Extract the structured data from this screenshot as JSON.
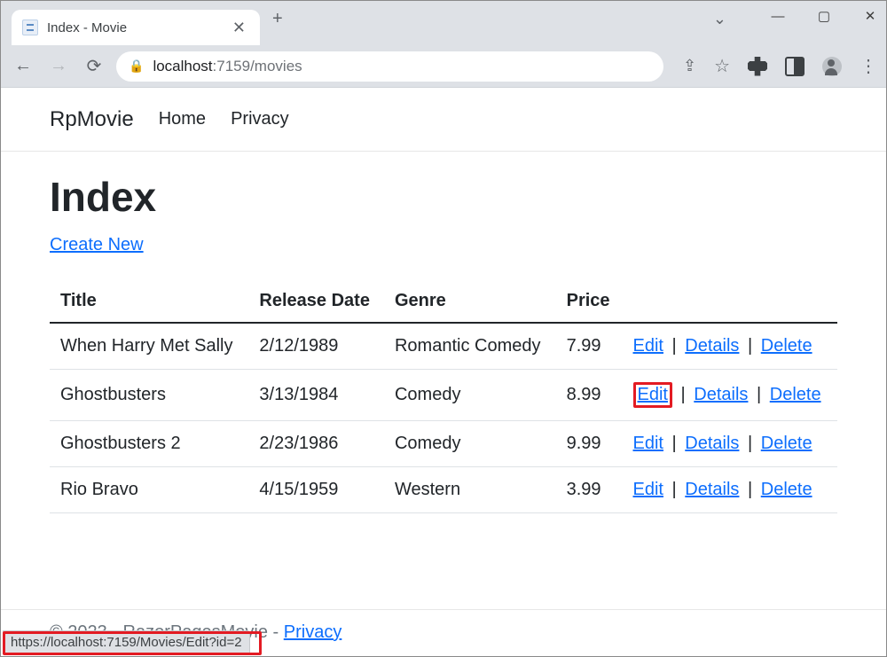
{
  "browser": {
    "tab_title": "Index - Movie",
    "url_host": "localhost",
    "url_rest": ":7159/movies",
    "status_url": "https://localhost:7159/Movies/Edit?id=2"
  },
  "nav": {
    "brand": "RpMovie",
    "links": [
      "Home",
      "Privacy"
    ]
  },
  "page": {
    "heading": "Index",
    "create_link": "Create New"
  },
  "table": {
    "headers": [
      "Title",
      "Release Date",
      "Genre",
      "Price",
      ""
    ],
    "action_labels": {
      "edit": "Edit",
      "details": "Details",
      "delete": "Delete"
    },
    "rows": [
      {
        "title": "When Harry Met Sally",
        "release": "2/12/1989",
        "genre": "Romantic Comedy",
        "price": "7.99",
        "highlight": false
      },
      {
        "title": "Ghostbusters",
        "release": "3/13/1984",
        "genre": "Comedy",
        "price": "8.99",
        "highlight": true
      },
      {
        "title": "Ghostbusters 2",
        "release": "2/23/1986",
        "genre": "Comedy",
        "price": "9.99",
        "highlight": false
      },
      {
        "title": "Rio Bravo",
        "release": "4/15/1959",
        "genre": "Western",
        "price": "3.99",
        "highlight": false
      }
    ]
  },
  "footer": {
    "copyright": "© 2023 - RazorPagesMovie - ",
    "privacy": "Privacy"
  }
}
